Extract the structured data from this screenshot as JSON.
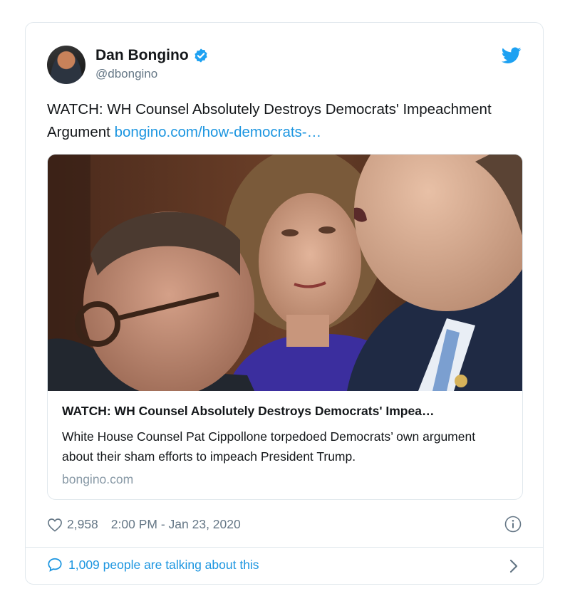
{
  "author": {
    "name": "Dan Bongino",
    "handle": "@dbongino",
    "verified": true
  },
  "tweet": {
    "text": "WATCH: WH Counsel Absolutely Destroys Democrats' Impeachment Argument ",
    "link_text": "bongino.com/how-democrats-…"
  },
  "link_card": {
    "title": "WATCH: WH Counsel Absolutely Destroys Democrats' Impea…",
    "description": "White House Counsel Pat Cippollone torpedoed Democrats’ own argument about their sham efforts to impeach President Trump.",
    "domain": "bongino.com"
  },
  "meta": {
    "likes": "2,958",
    "timestamp": "2:00 PM - Jan 23, 2020"
  },
  "conversation": {
    "label": "1,009 people are talking about this"
  },
  "icons": [
    "verified-badge-icon",
    "twitter-bird-icon",
    "heart-icon",
    "info-icon",
    "comment-bubble-icon",
    "chevron-right-icon"
  ],
  "colors": {
    "brand_blue": "#1da1f2",
    "link_blue": "#1b95e0",
    "muted_gray": "#657786",
    "domain_gray": "#8899a6",
    "border": "#e1e8ed"
  }
}
